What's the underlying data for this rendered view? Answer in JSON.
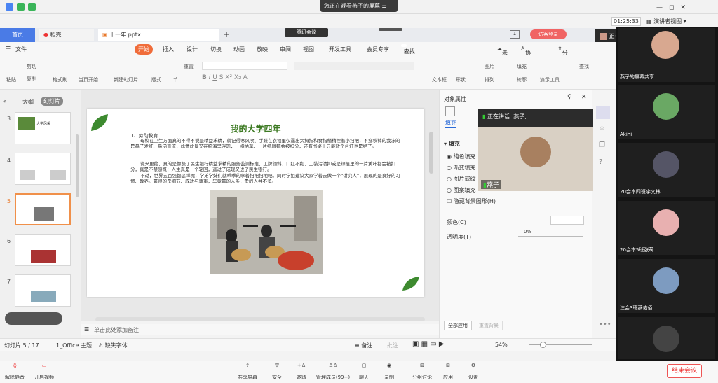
{
  "meeting": {
    "viewing": "您正在观看燕子的屏幕",
    "timer": "01:25:33",
    "presenter_view": "演讲者视图",
    "speaking": "正在讲话: 燕子;",
    "tencent": "腾讯会议",
    "end": "结束会议"
  },
  "wps": {
    "home_tab": "首页",
    "shell_tab": "稻壳",
    "doc_tab": "十一年.pptx",
    "login": "访客登录",
    "menu": [
      "文件",
      "开始",
      "插入",
      "设计",
      "切换",
      "动画",
      "放映",
      "审阅",
      "视图",
      "开发工具",
      "会员专享"
    ],
    "search": "查找命令、搜索模板",
    "sync": "未同步",
    "collab": "协作",
    "share": "分享",
    "ribbon": [
      "粘贴",
      "剪切",
      "复制",
      "格式刷",
      "当页开始",
      "新建幻灯片",
      "版式",
      "节",
      "重置",
      "文本框",
      "形状",
      "图片",
      "填充",
      "排列",
      "轮廓",
      "演示工具",
      "查找"
    ]
  },
  "left": {
    "outline": "大纲",
    "slides": "幻灯片",
    "numbers": [
      "3",
      "4",
      "5",
      "6",
      "7"
    ],
    "thumb3_title": "大学风采"
  },
  "slide": {
    "title": "我的大学四年",
    "heading": "1、劳动教育",
    "p1": "母校在卫生方面真的不得不说是精益求精，就记得寒风吹、手蜷在衣袖里仅漏出大拇指和食指稍稍捏着小扫把，不穿秋裤的我冻的是鼻子发红、鼻涕直流，此情此景又在脑海里浮现，一横枯草、一片纸屑都会被扣分，还有书桌上只能放个台灯也是绝了。",
    "p2": "说来更绝，真的是像极了民生银行精益求精的服务监测标准，工牌领斜、口红不红、工装污渍抑或是绿植里的一片黄叶都会被扣分，真是不禁感慨：人生真是一个轮回，逃过了成现又进了民生银行。",
    "p3": "不过，世界五百强都这样呢，学弟学妹们就乖乖的拿着扫把扫地吧。同时学姐建议大家学着去做一个“讲究人”，展现的是良好的习惯、教养。赢得的是细节、成功与尊重，毕竟赢的人多，贵的人并不多。"
  },
  "props": {
    "title": "对象属性",
    "fill_tab": "填充",
    "fill_section": "填充",
    "options": [
      "纯色填充",
      "渐变填充",
      "图片或纹",
      "图案填充"
    ],
    "hide_bg": "隐藏背景图形(H)",
    "color": "颜色(C)",
    "transparency": "透明度(T)",
    "trans_val": "0%",
    "apply_all": "全部应用",
    "reset_bg": "重置背景"
  },
  "speaker": {
    "name": "燕子",
    "speaking": "正在讲话: 燕子;"
  },
  "participants": [
    {
      "name": "燕子的屏幕共享"
    },
    {
      "name": "Akihi"
    },
    {
      "name": "20会本四班李文林"
    },
    {
      "name": "20会本5班张萌"
    },
    {
      "name": "注会3班蔡佑佰"
    },
    {
      "name": ""
    }
  ],
  "notes": "单击此处添加备注",
  "status": {
    "slide": "幻灯片 5 / 17",
    "theme": "1_Office 主题",
    "font": "缺失字体",
    "remarks": "备注",
    "comment": "批注",
    "zoom": "54%"
  },
  "toolbar": [
    "解除静音",
    "开启视频",
    "共享屏幕",
    "安全",
    "邀请",
    "管理成员(99+)",
    "聊天",
    "录制",
    "分组讨论",
    "应用",
    "设置"
  ]
}
